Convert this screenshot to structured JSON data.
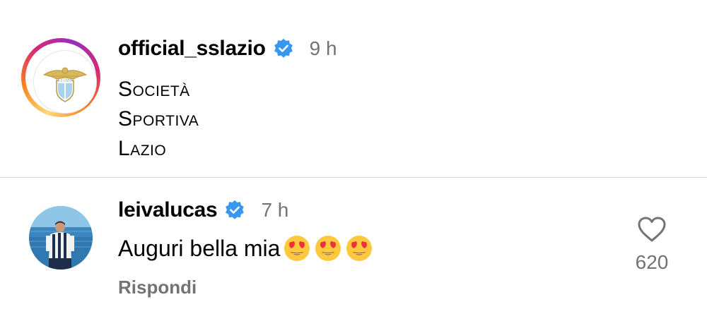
{
  "post": {
    "username": "official_sslazio",
    "verified_icon": "verified-badge-icon",
    "time": "9 h",
    "caption_lines": [
      "Società",
      "Sportiva",
      "Lazio"
    ],
    "avatar_icon": "lazio-eagle-crest-icon",
    "story_ring": true
  },
  "comment": {
    "username": "leivalucas",
    "verified_icon": "verified-badge-icon",
    "time": "7 h",
    "text": "Auguri bella mia",
    "emoji": [
      "😍",
      "😍",
      "😍"
    ],
    "reply_label": "Rispondi",
    "like_icon": "heart-outline-icon",
    "like_count": "620"
  },
  "colors": {
    "verified_blue": "#3897f0",
    "muted_text": "#737373",
    "divider": "#dbdbdb"
  }
}
